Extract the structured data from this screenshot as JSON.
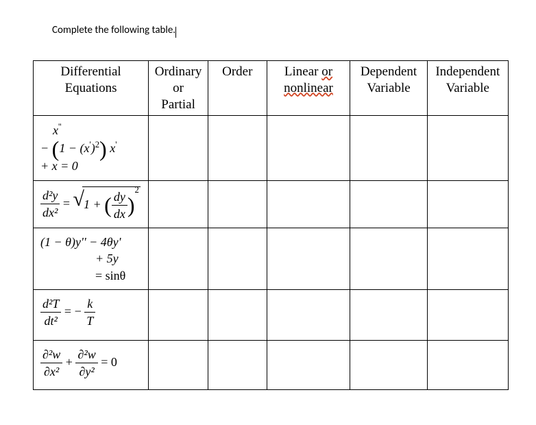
{
  "instruction": "Complete the following table.",
  "headers": {
    "eq": "Differential Equations",
    "op_line1": "Ordinary",
    "op_line2": "or",
    "op_line3": "Partial",
    "order": "Order",
    "lin_line1a": "Linear ",
    "lin_line1b": "or",
    "lin_line2": "nonlinear",
    "dep_line1": "Dependent",
    "dep_line2": "Variable",
    "ind_line1": "Independent",
    "ind_line2": "Variable"
  },
  "equations": {
    "eq1_line1": "x",
    "eq1_line2_a": "− ",
    "eq1_line2_b": "1 − (x",
    "eq1_line2_c": ")",
    "eq1_line2_sup1": "'",
    "eq1_line2_sup2": "2",
    "eq1_line2_d": " x",
    "eq1_line2_sup3": "'",
    "eq1_line3": "+ x = 0",
    "eq1_top_sup": "''",
    "eq2_frac1_num": "d²y",
    "eq2_frac1_den": "dx²",
    "eq2_eq": " = ",
    "eq2_under_sqrt_a": "1 + ",
    "eq2_inner_num": "dy",
    "eq2_inner_den": "dx",
    "eq2_outer_sup": "2",
    "eq3_line1": "(1 − θ)y'' − 4θy'",
    "eq3_line2": "+ 5y",
    "eq3_line3": "= sinθ",
    "eq4_frac1_num": "d²T",
    "eq4_frac1_den": "dt²",
    "eq4_mid": " = − ",
    "eq4_frac2_num": "k",
    "eq4_frac2_den": "T",
    "eq5_frac1_num": "∂²w",
    "eq5_frac1_den": "∂x²",
    "eq5_plus": " + ",
    "eq5_frac2_num": "∂²w",
    "eq5_frac2_den": "∂y²",
    "eq5_rhs": " = 0"
  },
  "chart_data": {
    "type": "table",
    "columns": [
      "Differential Equations",
      "Ordinary or Partial",
      "Order",
      "Linear or nonlinear",
      "Dependent Variable",
      "Independent Variable"
    ],
    "rows": [
      {
        "equation": "x'' - (1 - (x')^2) x' + x = 0",
        "ordinary_or_partial": "",
        "order": "",
        "linear_or_nonlinear": "",
        "dependent": "",
        "independent": ""
      },
      {
        "equation": "d^2y/dx^2 = sqrt(1 + (dy/dx)^2)",
        "ordinary_or_partial": "",
        "order": "",
        "linear_or_nonlinear": "",
        "dependent": "",
        "independent": ""
      },
      {
        "equation": "(1 - θ) y'' - 4θ y' + 5y = sinθ",
        "ordinary_or_partial": "",
        "order": "",
        "linear_or_nonlinear": "",
        "dependent": "",
        "independent": ""
      },
      {
        "equation": "d^2T/dt^2 = -k/T",
        "ordinary_or_partial": "",
        "order": "",
        "linear_or_nonlinear": "",
        "dependent": "",
        "independent": ""
      },
      {
        "equation": "∂^2w/∂x^2 + ∂^2w/∂y^2 = 0",
        "ordinary_or_partial": "",
        "order": "",
        "linear_or_nonlinear": "",
        "dependent": "",
        "independent": ""
      }
    ]
  }
}
